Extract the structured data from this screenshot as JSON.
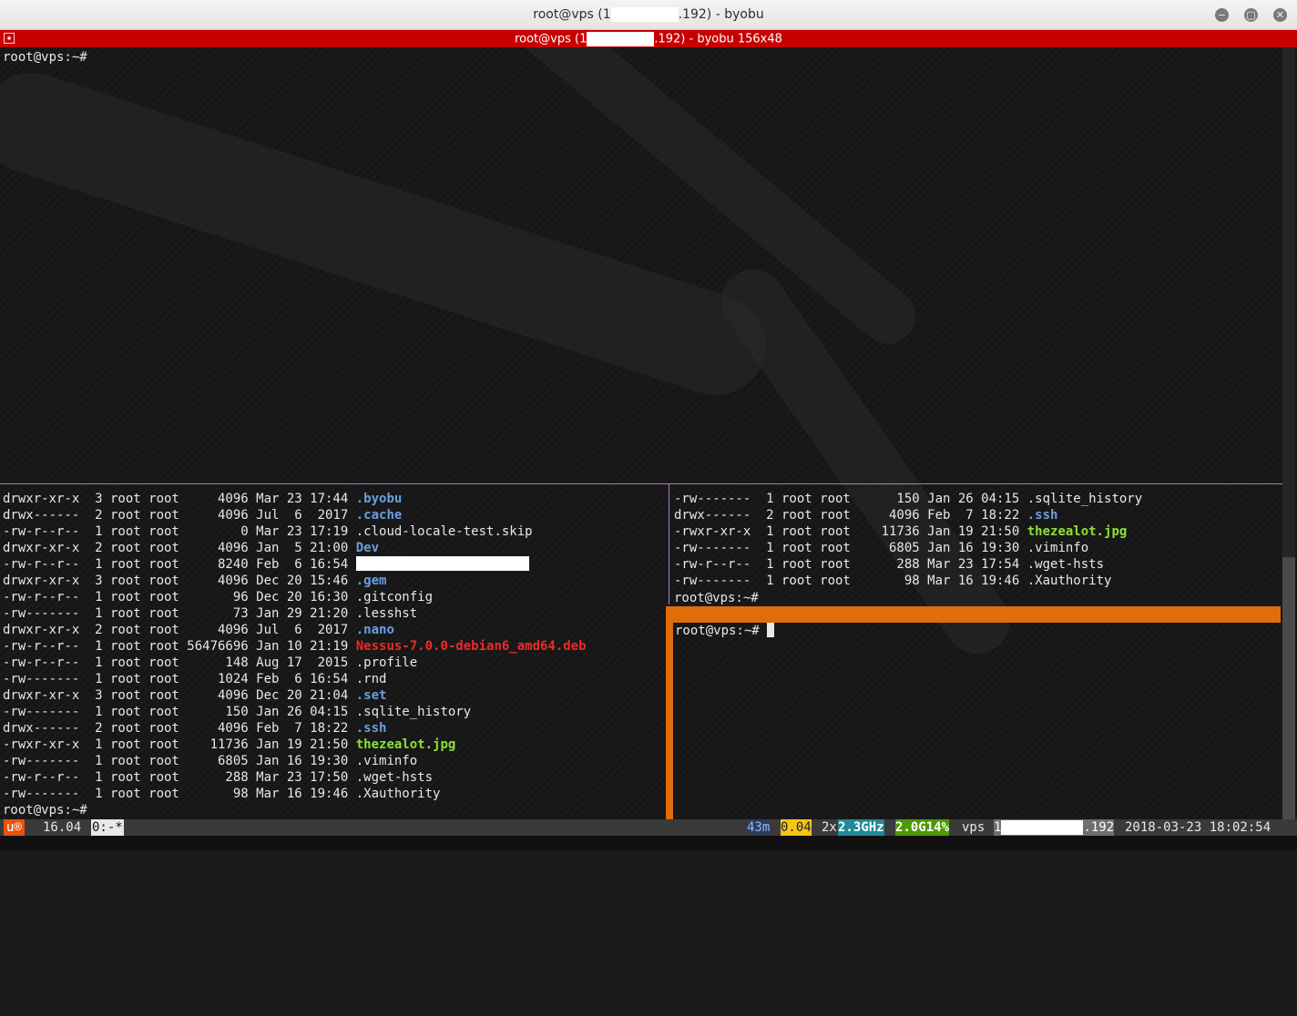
{
  "window": {
    "title_prefix": "root@vps (1",
    "title_suffix": ".192) - byobu",
    "min_glyph": "−",
    "max_glyph": "▢",
    "close_glyph": "✕"
  },
  "byobu": {
    "title_prefix": "root@vps (1",
    "title_suffix": ".192) - byobu 156x48",
    "icon_glyph": "▪"
  },
  "top_pane": {
    "prompt": "root@vps:~#"
  },
  "left_pane": {
    "rows": [
      {
        "text": "drwxr-xr-x  3 root root     4096 Mar 23 17:44 ",
        "name": ".byobu",
        "kind": "dir"
      },
      {
        "text": "drwx------  2 root root     4096 Jul  6  2017 ",
        "name": ".cache",
        "kind": "dir"
      },
      {
        "text": "-rw-r--r--  1 root root        0 Mar 23 17:19 ",
        "name": ".cloud-locale-test.skip",
        "kind": "file"
      },
      {
        "text": "drwxr-xr-x  2 root root     4096 Jan  5 21:00 ",
        "name": "Dev",
        "kind": "dir"
      },
      {
        "text": "-rw-r--r--  1 root root     8240 Feb  6 16:54 ",
        "name": "",
        "kind": "redacted"
      },
      {
        "text": "drwxr-xr-x  3 root root     4096 Dec 20 15:46 ",
        "name": ".gem",
        "kind": "dir"
      },
      {
        "text": "-rw-r--r--  1 root root       96 Dec 20 16:30 ",
        "name": ".gitconfig",
        "kind": "file"
      },
      {
        "text": "-rw-------  1 root root       73 Jan 29 21:20 ",
        "name": ".lesshst",
        "kind": "file"
      },
      {
        "text": "drwxr-xr-x  2 root root     4096 Jul  6  2017 ",
        "name": ".nano",
        "kind": "dir"
      },
      {
        "text": "-rw-r--r--  1 root root 56476696 Jan 10 21:19 ",
        "name": "Nessus-7.0.0-debian6_amd64.deb",
        "kind": "pkg"
      },
      {
        "text": "-rw-r--r--  1 root root      148 Aug 17  2015 ",
        "name": ".profile",
        "kind": "file"
      },
      {
        "text": "-rw-------  1 root root     1024 Feb  6 16:54 ",
        "name": ".rnd",
        "kind": "file"
      },
      {
        "text": "drwxr-xr-x  3 root root     4096 Dec 20 21:04 ",
        "name": ".set",
        "kind": "dir"
      },
      {
        "text": "-rw-------  1 root root      150 Jan 26 04:15 ",
        "name": ".sqlite_history",
        "kind": "file"
      },
      {
        "text": "drwx------  2 root root     4096 Feb  7 18:22 ",
        "name": ".ssh",
        "kind": "dir"
      },
      {
        "text": "-rwxr-xr-x  1 root root    11736 Jan 19 21:50 ",
        "name": "thezealot.jpg",
        "kind": "exec"
      },
      {
        "text": "-rw-------  1 root root     6805 Jan 16 19:30 ",
        "name": ".viminfo",
        "kind": "file"
      },
      {
        "text": "-rw-r--r--  1 root root      288 Mar 23 17:50 ",
        "name": ".wget-hsts",
        "kind": "file"
      },
      {
        "text": "-rw-------  1 root root       98 Mar 16 19:46 ",
        "name": ".Xauthority",
        "kind": "file"
      }
    ],
    "prompt": "root@vps:~#"
  },
  "right_pane": {
    "rows": [
      {
        "text": "-rw-------  1 root root      150 Jan 26 04:15 ",
        "name": ".sqlite_history",
        "kind": "file"
      },
      {
        "text": "drwx------  2 root root     4096 Feb  7 18:22 ",
        "name": ".ssh",
        "kind": "dir"
      },
      {
        "text": "-rwxr-xr-x  1 root root    11736 Jan 19 21:50 ",
        "name": "thezealot.jpg",
        "kind": "exec"
      },
      {
        "text": "-rw-------  1 root root     6805 Jan 16 19:30 ",
        "name": ".viminfo",
        "kind": "file"
      },
      {
        "text": "-rw-r--r--  1 root root      288 Mar 23 17:54 ",
        "name": ".wget-hsts",
        "kind": "file"
      },
      {
        "text": "-rw-------  1 root root       98 Mar 16 19:46 ",
        "name": ".Xauthority",
        "kind": "file"
      }
    ],
    "prompt": "root@vps:~#"
  },
  "active_pane": {
    "prompt": "root@vps:~# "
  },
  "status": {
    "logo": "u®",
    "release": "16.04",
    "window": "0:-*",
    "uptime": "43m",
    "load": "0.04",
    "cpu_count": "2x",
    "cpu_freq": "2.3GHz",
    "mem": "2.0G14%",
    "host": "vps",
    "ip_prefix": "1",
    "ip_suffix": ".192",
    "datetime": "2018-03-23 18:02:54"
  },
  "colors": {
    "byobu_bar": "#c70000",
    "active_border": "#e06c0a",
    "dir": "#6a9fe0",
    "exec": "#8ae234",
    "pkg": "#ef2929"
  }
}
